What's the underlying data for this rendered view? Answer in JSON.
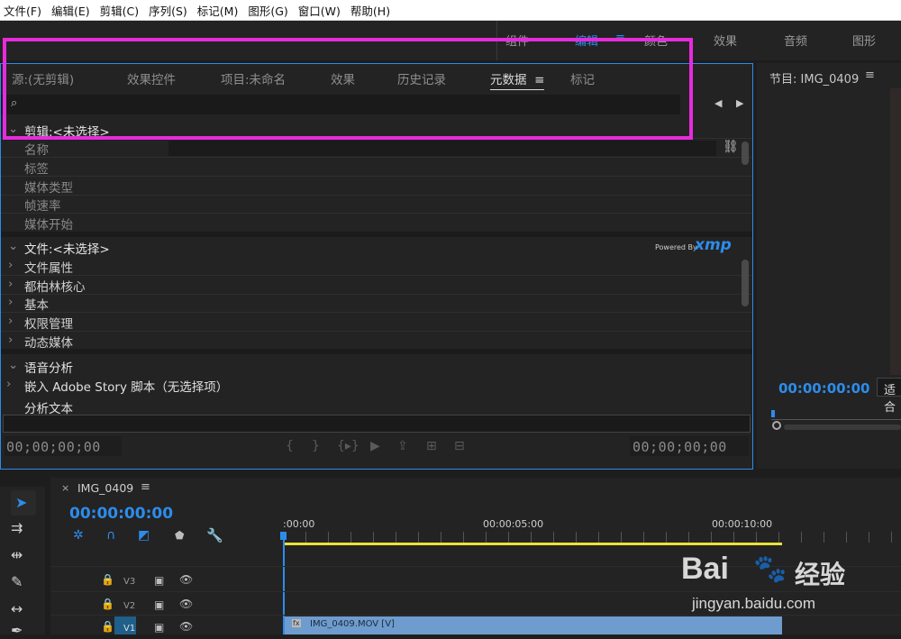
{
  "menubar": [
    "文件(F)",
    "编辑(E)",
    "剪辑(C)",
    "序列(S)",
    "标记(M)",
    "图形(G)",
    "窗口(W)",
    "帮助(H)"
  ],
  "workspaces": {
    "items": [
      "组件",
      "编辑",
      "颜色",
      "效果",
      "音频",
      "图形"
    ],
    "active": "编辑",
    "menu_icon": "hamburger-icon"
  },
  "meta_panel": {
    "tabs": [
      "源:(无剪辑)",
      "效果控件",
      "项目:未命名",
      "效果",
      "历史记录",
      "元数据",
      "标记"
    ],
    "active_tab": "元数据",
    "search_placeholder": "",
    "clip_header": "剪辑:<未选择>",
    "clip_fields": [
      "名称",
      "标签",
      "媒体类型",
      "帧速率",
      "媒体开始"
    ],
    "file_header": "文件:<未选择>",
    "powered_by": "Powered By",
    "xmp": "xmp",
    "file_groups": [
      "文件属性",
      "都柏林核心",
      "基本",
      "权限管理",
      "动态媒体"
    ],
    "speech_header": "语音分析",
    "embed_label": "嵌入 Adobe Story 脚本（无选择项）",
    "analysis_text": "分析文本",
    "timecode_left": "00;00;00;00",
    "timecode_right": "00;00;00;00"
  },
  "program": {
    "title": "节目: IMG_0409",
    "timecode": "00:00:00:00",
    "fit": "适合"
  },
  "timeline": {
    "sequence": "IMG_0409",
    "timecode": "00:00:00:00",
    "ruler": [
      ":00:00",
      "00:00:05:00",
      "00:00:10:00"
    ],
    "tracks": [
      "V3",
      "V2",
      "V1"
    ],
    "clip": "IMG_0409.MOV [V]",
    "fx": "fx"
  },
  "colors": {
    "accent": "#2d8ceb",
    "highlight": "#e62bdc",
    "clip": "#6e9ccf",
    "work_area": "#e8e23a"
  },
  "watermark": {
    "brand": "Bai",
    "brand_cn": "经验",
    "url": "jingyan.baidu.com"
  }
}
